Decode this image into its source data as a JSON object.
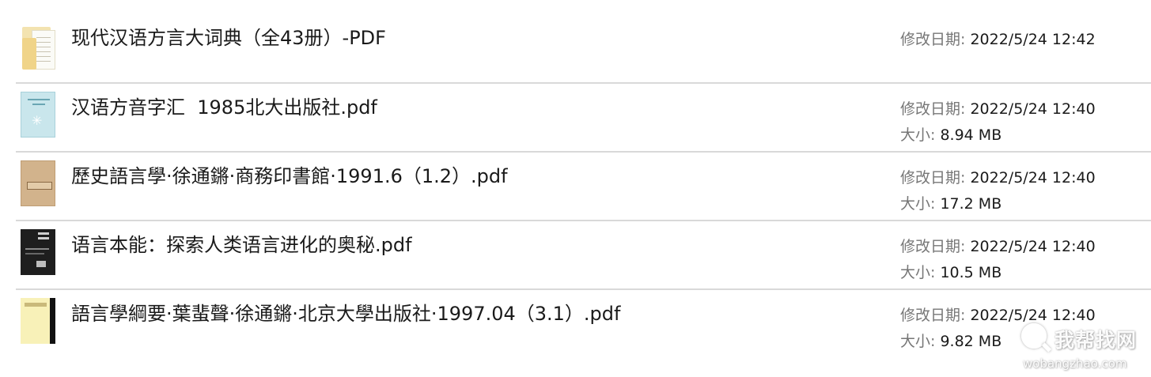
{
  "files": [
    {
      "name": "现代汉语方言大词典（全43册）-PDF",
      "thumbnail": "folder-icon",
      "modified_label": "修改日期:",
      "modified_value": "2022/5/24 12:42"
    },
    {
      "name": "汉语方音字汇  1985北大出版社.pdf",
      "thumbnail": "book-cover",
      "modified_label": "修改日期:",
      "modified_value": "2022/5/24 12:40",
      "size_label": "大小:",
      "size_value": "8.94 MB"
    },
    {
      "name": "歷史語言學·徐通鏘·商務印書館·1991.6（1.2）.pdf",
      "thumbnail": "book-cover",
      "modified_label": "修改日期:",
      "modified_value": "2022/5/24 12:40",
      "size_label": "大小:",
      "size_value": "17.2 MB"
    },
    {
      "name": "语言本能：探索人类语言进化的奥秘.pdf",
      "thumbnail": "book-cover",
      "modified_label": "修改日期:",
      "modified_value": "2022/5/24 12:40",
      "size_label": "大小:",
      "size_value": "10.5 MB"
    },
    {
      "name": "語言學綱要·葉蜚聲·徐通鏘·北京大學出版社·1997.04（3.1）.pdf",
      "thumbnail": "book-cover",
      "modified_label": "修改日期:",
      "modified_value": "2022/5/24 12:40",
      "size_label": "大小:",
      "size_value": "9.82 MB"
    }
  ],
  "watermark": {
    "title": "我帮找网",
    "url": "wobangzhao.com"
  }
}
